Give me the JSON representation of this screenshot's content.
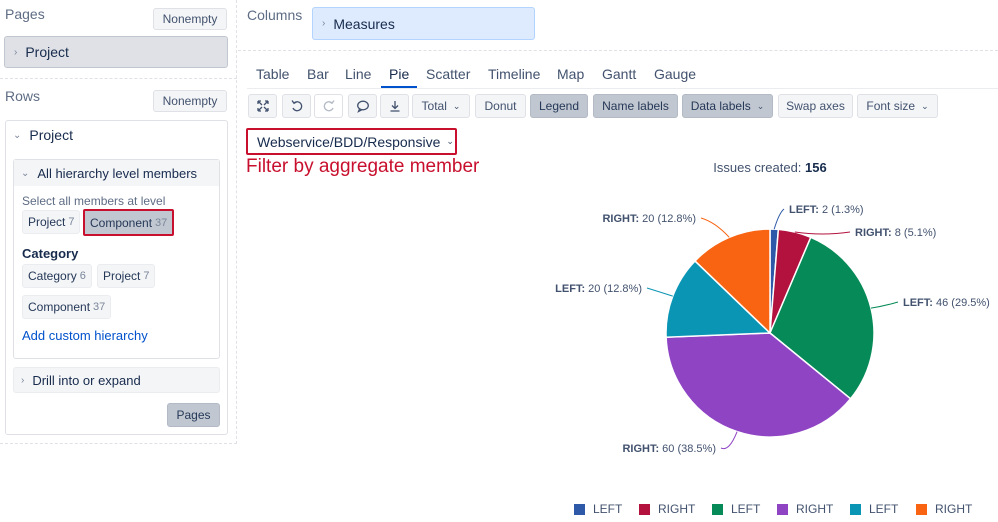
{
  "left": {
    "pages_label": "Pages",
    "pages_nonempty": "Nonempty",
    "pages_project": "Project",
    "rows_label": "Rows",
    "rows_nonempty": "Nonempty",
    "rows_project": "Project",
    "hierarchy_header": "All hierarchy level members",
    "select_label": "Select all members at level",
    "chip_project": "Project",
    "chip_project_count": "7",
    "chip_component": "Component",
    "chip_component_count": "37",
    "category_heading": "Category",
    "chip_category": "Category",
    "chip_category_count": "6",
    "chip_project2": "Project",
    "chip_project2_count": "7",
    "chip_component2": "Component",
    "chip_component2_count": "37",
    "add_custom": "Add custom hierarchy",
    "drill": "Drill into or expand",
    "pages_button": "Pages"
  },
  "columns": {
    "label": "Columns",
    "measures": "Measures"
  },
  "tabs": [
    "Table",
    "Bar",
    "Line",
    "Pie",
    "Scatter",
    "Timeline",
    "Map",
    "Gantt",
    "Gauge"
  ],
  "active_tab": "Pie",
  "toolbar": {
    "total": "Total",
    "donut": "Donut",
    "legend": "Legend",
    "name_labels": "Name labels",
    "data_labels": "Data labels",
    "swap_axes": "Swap axes",
    "font_size": "Font size"
  },
  "filter": {
    "value": "Webservice/BDD/Responsive",
    "annotation": "Filter by aggregate member"
  },
  "chart_data": {
    "type": "pie",
    "title_label": "Issues created:",
    "title_value": "156",
    "total": 156,
    "slices": [
      {
        "name": "LEFT",
        "value": 2,
        "percent": "1.3%",
        "color": "#2e59a8",
        "label": "LEFT: 2 (1.3%)"
      },
      {
        "name": "RIGHT",
        "value": 8,
        "percent": "5.1%",
        "color": "#b3123e",
        "label": "RIGHT: 8 (5.1%)"
      },
      {
        "name": "LEFT",
        "value": 46,
        "percent": "29.5%",
        "color": "#068a57",
        "label": "LEFT: 46 (29.5%)"
      },
      {
        "name": "RIGHT",
        "value": 60,
        "percent": "38.5%",
        "color": "#8f44c4",
        "label": "RIGHT: 60 (38.5%)"
      },
      {
        "name": "LEFT",
        "value": 20,
        "percent": "12.8%",
        "color": "#0b95b5",
        "label": "LEFT: 20 (12.8%)"
      },
      {
        "name": "RIGHT",
        "value": 20,
        "percent": "12.8%",
        "color": "#f86412",
        "label": "RIGHT: 20 (12.8%)"
      }
    ],
    "legend_position": "bottom"
  }
}
